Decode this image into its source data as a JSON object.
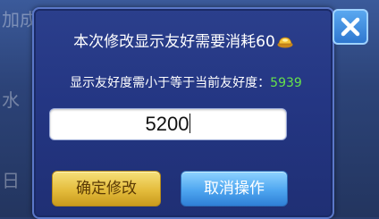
{
  "background": {
    "left_fragment_1": "加成",
    "left_fragment_2": "水",
    "left_fragment_3": "日"
  },
  "dialog": {
    "title": "本次修改显示友好需要消耗60",
    "info_label": "显示友好度需小于等于当前友好度：",
    "info_value": "5939",
    "input_value": "5200",
    "confirm_label": "确定修改",
    "cancel_label": "取消操作",
    "icons": {
      "currency": "gold-ingot-icon",
      "close": "close-icon"
    }
  },
  "colors": {
    "dialog_bg": "#243683",
    "value_green": "#66e34a",
    "confirm_gold": "#e4bc3c",
    "cancel_blue": "#4ea6f0"
  }
}
